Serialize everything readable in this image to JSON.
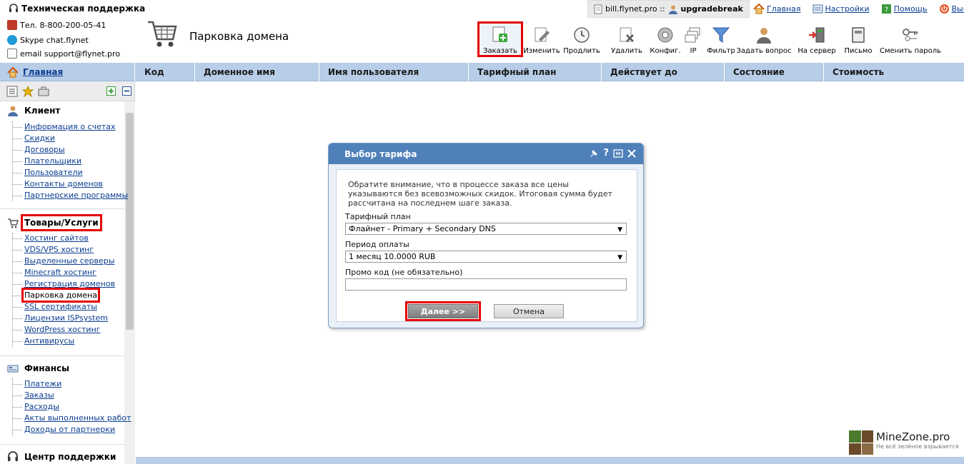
{
  "header": {
    "support_title": "Техническая поддержка",
    "phone": "Тел. 8-800-200-05-41",
    "skype": "Skype chat.flynet",
    "email": "email support@flynet.pro",
    "page_title": "Парковка домена"
  },
  "userbar": {
    "server": "bill.flynet.pro ::",
    "username": "upgradebreak"
  },
  "toplinks": {
    "home": "Главная",
    "settings": "Настройки",
    "help": "Помощь",
    "logout": "Выйт"
  },
  "toolbar": [
    {
      "label": "Заказать",
      "icon": "order-icon"
    },
    {
      "label": "Изменить",
      "icon": "edit-icon"
    },
    {
      "label": "Продлить",
      "icon": "renew-icon"
    },
    {
      "label": "Удалить",
      "icon": "delete-icon"
    },
    {
      "label": "Конфиг.",
      "icon": "config-icon"
    },
    {
      "label": "IP",
      "icon": "ip-icon"
    },
    {
      "label": "Фильтр",
      "icon": "filter-icon"
    },
    {
      "label": "Задать вопрос",
      "icon": "question-icon"
    },
    {
      "label": "На сервер",
      "icon": "server-icon"
    },
    {
      "label": "Письмо",
      "icon": "letter-icon"
    },
    {
      "label": "Сменить пароль",
      "icon": "password-icon"
    }
  ],
  "table": {
    "home": "Главная",
    "columns": [
      "Код",
      "Доменное имя",
      "Имя пользователя",
      "Тарифный план",
      "Действует до",
      "Состояние",
      "Стоимость"
    ]
  },
  "sidebar": {
    "client": {
      "title": "Клиент",
      "items": [
        "Информация о счетах",
        "Скидки",
        "Договоры",
        "Плательщики",
        "Пользователи",
        "Контакты доменов",
        "Партнерские программы"
      ]
    },
    "goods": {
      "title": "Товары/Услуги",
      "items": [
        "Хостинг сайтов",
        "VDS/VPS хостинг",
        "Выделенные серверы",
        "Minecraft хостинг",
        "Регистрация доменов",
        "Парковка домена",
        "SSL сертификаты",
        "Лицензии ISPsystem",
        "WordPress хостинг",
        "Антивирусы"
      ]
    },
    "finance": {
      "title": "Финансы",
      "items": [
        "Платежи",
        "Заказы",
        "Расходы",
        "Акты выполненных работ",
        "Доходы от партнерки"
      ]
    },
    "support": {
      "title": "Центр поддержки"
    }
  },
  "dialog": {
    "title": "Выбор тарифа",
    "notice": "Обратите внимание, что в процессе заказа все цены указываются без всевозможных скидок. Итоговая сумма будет рассчитана на последнем шаге заказа.",
    "plan_label": "Тарифный план",
    "plan_value": "Флайнет - Primary + Secondary DNS",
    "period_label": "Период оплаты",
    "period_value": "1 месяц 10.0000 RUB",
    "promo_label": "Промо код (не обязательно)",
    "promo_value": "",
    "next": "Далее >>",
    "cancel": "Отмена"
  },
  "watermark": {
    "name": "MineZone.pro",
    "tagline": "Не всё зелёное взрывается"
  }
}
